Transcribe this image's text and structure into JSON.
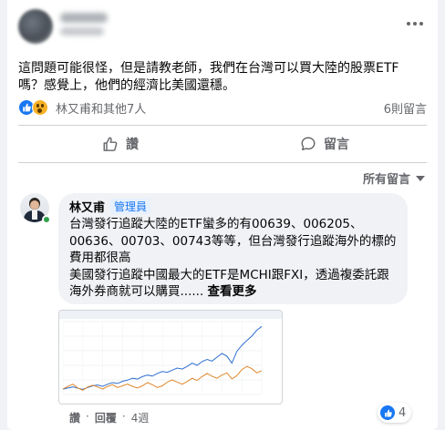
{
  "post": {
    "text": "這問題可能很怪，但是請教老師，我們在台灣可以買大陸的股票ETF嗎？感覺上，他們的經濟比美國還穩。",
    "reaction_names": "林又甫和其他7人",
    "comment_count": "6則留言"
  },
  "actions": {
    "like_label": "讚",
    "comment_label": "留言"
  },
  "sort": {
    "label": "所有留言"
  },
  "comment": {
    "author": "林又甫",
    "badge": "管理員",
    "text": "台灣發行追蹤大陸的ETF蠻多的有00639、006205、00636、00703、00743等等，但台灣發行追蹤海外的標的費用都很高\n美國發行追蹤中國最大的ETF是MCHI跟FXI，透過複委託跟海外券商就可以購買......",
    "see_more": "查看更多",
    "like_action": "讚",
    "reply_action": "回覆",
    "time": "4週",
    "reaction_count": "4"
  },
  "colors": {
    "accent": "#1877f2",
    "online": "#31a24c",
    "series_blue": "#2f6fd0",
    "series_orange": "#e0872a"
  },
  "chart_data": {
    "type": "line",
    "x": [
      0,
      1,
      2,
      3,
      4,
      5,
      6,
      7,
      8,
      9,
      10,
      11,
      12,
      13,
      14,
      15,
      16,
      17,
      18,
      19,
      20,
      21,
      22,
      23,
      24,
      25,
      26,
      27,
      28,
      29,
      30,
      31,
      32,
      33,
      34,
      35,
      36,
      37,
      38,
      39,
      40
    ],
    "series": [
      {
        "values": [
          100,
          104,
          108,
          103,
          99,
          106,
          112,
          115,
          110,
          118,
          124,
          121,
          129,
          133,
          140,
          137,
          146,
          152,
          148,
          158,
          165,
          162,
          170,
          178,
          174,
          184,
          196,
          188,
          202,
          210,
          204,
          218,
          232,
          222,
          196,
          240,
          262,
          280,
          296,
          318,
          332
        ]
      },
      {
        "values": [
          100,
          110,
          118,
          104,
          96,
          108,
          114,
          108,
          100,
          110,
          116,
          106,
          112,
          118,
          110,
          104,
          112,
          124,
          116,
          106,
          112,
          126,
          134,
          126,
          118,
          128,
          140,
          132,
          146,
          158,
          148,
          140,
          152,
          160,
          138,
          150,
          172,
          184,
          176,
          160,
          168
        ]
      }
    ],
    "ylim": [
      80,
      350
    ],
    "grid": true
  }
}
